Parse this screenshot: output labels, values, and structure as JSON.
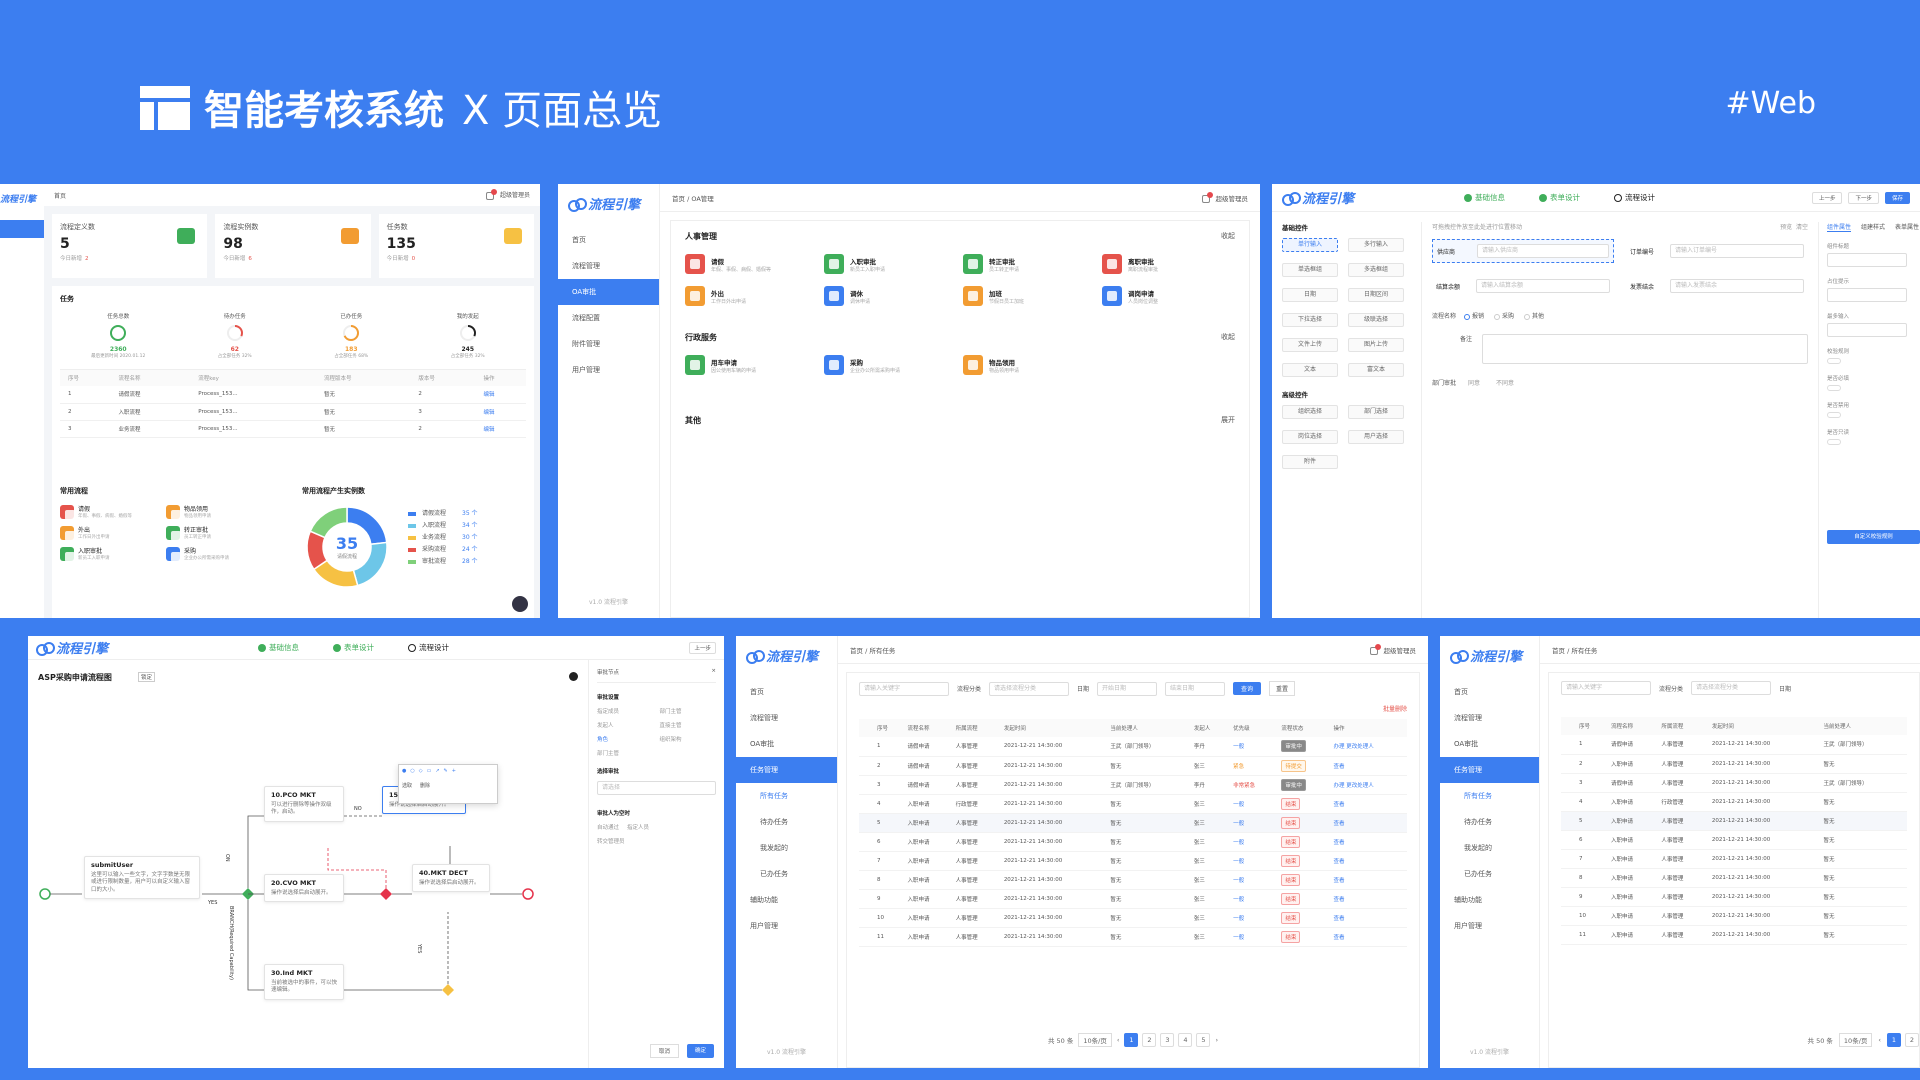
{
  "header": {
    "title": "智能考核系统",
    "subtitle": "X 页面总览",
    "tag": "#Web"
  },
  "brand": "流程引擎",
  "version": "v1.0 流程引擎",
  "dashboard": {
    "crumb": "首页",
    "user": "超级管理员",
    "stats": [
      {
        "label": "流程定义数",
        "value": "5",
        "sub_label": "今日新增",
        "sub_value": "2",
        "color": "#3fae5a"
      },
      {
        "label": "流程实例数",
        "value": "98",
        "sub_label": "今日新增",
        "sub_value": "6",
        "color": "#f29c32"
      },
      {
        "label": "任务数",
        "value": "135",
        "sub_label": "今日新增",
        "sub_value": "0",
        "color": "#f6c143"
      }
    ],
    "task_title": "任务",
    "task_stats": [
      {
        "label": "任务总数",
        "value": "2360",
        "note": "最后更新时间 2020.01.12",
        "progress": 1.0,
        "color": "#3fae5a"
      },
      {
        "label": "待办任务",
        "value": "62",
        "note": "占全部任务 32%",
        "progress": 0.32,
        "color": "#e5534b"
      },
      {
        "label": "已办任务",
        "value": "183",
        "note": "占全部任务 68%",
        "progress": 0.68,
        "color": "#f29c32"
      },
      {
        "label": "我的发起",
        "value": "245",
        "note": "占全部任务 32%",
        "progress": 0.32,
        "color": "#222"
      }
    ],
    "table_headers": [
      "序号",
      "流程名称",
      "流程key",
      "流程版本号",
      "版本号",
      "操作"
    ],
    "table_rows": [
      [
        "1",
        "请假流程",
        "Process_153...",
        "暂无",
        "2",
        "编辑"
      ],
      [
        "2",
        "入职流程",
        "Process_153...",
        "暂无",
        "3",
        "编辑"
      ],
      [
        "3",
        "业务流程",
        "Process_153...",
        "暂无",
        "2",
        "编辑"
      ]
    ],
    "common_title": "常用流程",
    "common": [
      {
        "name": "请假",
        "desc": "年假、事假、病假、婚假等",
        "color": "red"
      },
      {
        "name": "物品领用",
        "desc": "物品领用申请",
        "color": "orange"
      },
      {
        "name": "外出",
        "desc": "工作日外出申请",
        "color": "orange"
      },
      {
        "name": "转正审批",
        "desc": "员工转正申请",
        "color": "green"
      },
      {
        "name": "入职审批",
        "desc": "新员工入职申请",
        "color": "green"
      },
      {
        "name": "采购",
        "desc": "企业办公所需采购申请",
        "color": "blue"
      }
    ],
    "donut_title": "常用流程产生实例数",
    "donut_center": "35",
    "donut_center_label": "请假流程",
    "legend": [
      {
        "name": "请假流程",
        "value": "35 个",
        "color": "#3c7ef0"
      },
      {
        "name": "入职流程",
        "value": "34 个",
        "color": "#6dc6e8"
      },
      {
        "name": "业务流程",
        "value": "30 个",
        "color": "#f6c143"
      },
      {
        "name": "采购流程",
        "value": "24 个",
        "color": "#e5534b"
      },
      {
        "name": "审批流程",
        "value": "28 个",
        "color": "#7fd07a"
      }
    ]
  },
  "oa": {
    "crumb": "首页 / OA管理",
    "user": "超级管理员",
    "menu": [
      {
        "label": "首页",
        "on": false
      },
      {
        "label": "流程管理",
        "on": false
      },
      {
        "label": "OA审批",
        "on": true
      },
      {
        "label": "流程配置",
        "on": false
      },
      {
        "label": "附件管理",
        "on": false
      },
      {
        "label": "用户管理",
        "on": false
      }
    ],
    "section1": "人事管理",
    "section1_items": [
      {
        "name": "请假",
        "desc": "年假、事假、病假、婚假等",
        "color": "red"
      },
      {
        "name": "入职审批",
        "desc": "新员工入职申请",
        "color": "green"
      },
      {
        "name": "转正审批",
        "desc": "员工转正申请",
        "color": "green"
      },
      {
        "name": "离职审批",
        "desc": "离职流程审批",
        "color": "red"
      },
      {
        "name": "外出",
        "desc": "工作日外出申请",
        "color": "orange"
      },
      {
        "name": "调休",
        "desc": "调休申请",
        "color": "blue"
      },
      {
        "name": "加班",
        "desc": "节假日员工加班",
        "color": "orange"
      },
      {
        "name": "调岗申请",
        "desc": "人员岗位调整",
        "color": "blue"
      }
    ],
    "section2": "行政服务",
    "section2_items": [
      {
        "name": "用车申请",
        "desc": "因公使用车辆的申请",
        "color": "green"
      },
      {
        "name": "采购",
        "desc": "企业办公所需采购申请",
        "color": "blue"
      },
      {
        "name": "物品领用",
        "desc": "物品领用申请",
        "color": "orange"
      }
    ],
    "section3": "其他",
    "collapse": "收起",
    "expand": "展开"
  },
  "form": {
    "steps": [
      "基础信息",
      "表单设计",
      "流程设计"
    ],
    "buttons": [
      "上一步",
      "下一步",
      "保存"
    ],
    "basic": "基础控件",
    "controls": [
      "单行输入",
      "多行输入",
      "单选框组",
      "多选框组",
      "日期",
      "日期区间",
      "下拉选择",
      "级联选择",
      "文件上传",
      "图片上传",
      "文本",
      "富文本"
    ],
    "advanced": "高级控件",
    "adv_controls": [
      "组织选择",
      "部门选择",
      "岗位选择",
      "用户选择",
      "附件"
    ],
    "hint": "可拖拽控件放至此处进行位置移动",
    "preview": "预览",
    "clear": "清空",
    "fields": [
      {
        "label": "供应商",
        "ph": "请输入供应商"
      },
      {
        "label": "订单编号",
        "ph": "请输入订单编号"
      },
      {
        "label": "结算余额",
        "ph": "请输入结算余额"
      },
      {
        "label": "发票结余",
        "ph": "请输入发票结余"
      }
    ],
    "radio_label": "流程名称",
    "radios": [
      "报销",
      "采购",
      "其他"
    ],
    "remark": "备注",
    "dept_label": "部门审批",
    "dept_opts": [
      "同意",
      "不同意"
    ],
    "tabs": [
      "组件属性",
      "组建样式",
      "表单属性"
    ],
    "props": [
      "组件标题",
      "占位提示",
      "最多输入",
      "校验规则",
      "是否必填",
      "是否禁用",
      "是否只读"
    ],
    "save_btn": "自定义校验规则"
  },
  "flow": {
    "steps": [
      "基础信息",
      "表单设计",
      "流程设计"
    ],
    "prev": "上一步",
    "title": "ASP采购申请流程图",
    "lock": "锁定",
    "nodes": [
      {
        "name": "submitUser",
        "desc": "这里可以输入一些文字，文字字数是无限或进行限制数量，用户可以自定义输入窗口的大小。"
      },
      {
        "name": "10.PCO MKT",
        "desc": "可以进行删除等操作双级作，启动。"
      },
      {
        "name": "20.CVO MKT",
        "desc": "操作说选择后启动展开。"
      },
      {
        "name": "15.PCO MKT",
        "desc": "操作说选择后启动展开。"
      },
      {
        "name": "40.MKT DECT",
        "desc": "操作说选择后启动展开。"
      },
      {
        "name": "30.Ind MKT",
        "desc": "当前被选中的事件，可以快速编辑。"
      }
    ],
    "labels": [
      "YES",
      "NO",
      "ON",
      "YES",
      "BRANCH(Required Capability)"
    ],
    "popup": [
      "选取",
      "删除"
    ],
    "panel_title": "审批节点",
    "panel_sections": [
      "审批设置",
      "选择审批",
      "审批人为空时"
    ],
    "panel_opts": [
      "指定成员",
      "部门主管",
      "发起人",
      "直接主管",
      "角色",
      "组织架构",
      "部门主管",
      "请选择",
      "自动通过",
      "指定人员",
      "转交管理员"
    ],
    "cancel": "取消",
    "ok": "确定"
  },
  "list": {
    "crumb": "首页 / 所有任务",
    "user": "超级管理员",
    "menu": [
      {
        "label": "首页",
        "on": false,
        "sub": false
      },
      {
        "label": "流程管理",
        "on": false,
        "sub": false
      },
      {
        "label": "OA审批",
        "on": false,
        "sub": false
      },
      {
        "label": "任务管理",
        "on": true,
        "sub": false
      },
      {
        "label": "所有任务",
        "on": false,
        "sub": true,
        "active": true
      },
      {
        "label": "待办任务",
        "on": false,
        "sub": true
      },
      {
        "label": "我发起的",
        "on": false,
        "sub": true
      },
      {
        "label": "已办任务",
        "on": false,
        "sub": true
      },
      {
        "label": "辅助功能",
        "on": false,
        "sub": false
      },
      {
        "label": "用户管理",
        "on": false,
        "sub": false
      }
    ],
    "search_ph": "请输入关键字",
    "cat_label": "流程分类",
    "cat_ph": "请选择流程分类",
    "date_label": "日期",
    "date_ph": [
      "开始日期",
      "结束日期"
    ],
    "query": "查询",
    "reset": "重置",
    "batch_del": "批量删除",
    "headers": [
      "序号",
      "流程名称",
      "所属流程",
      "发起时间",
      "当前处理人",
      "发起人",
      "优先级",
      "流程状态",
      "操作"
    ],
    "rows": [
      [
        "1",
        "请假申请",
        "人事管理",
        "2021-12-21 14:30:00",
        "王武（部门领导）",
        "李丹",
        "一般",
        "审批中",
        "办理  更改处理人"
      ],
      [
        "2",
        "请假申请",
        "人事管理",
        "2021-12-21 14:30:00",
        "暂无",
        "张三",
        "紧急",
        "待提交",
        "查看"
      ],
      [
        "3",
        "请假申请",
        "人事管理",
        "2021-12-21 14:30:00",
        "王武（部门领导）",
        "李丹",
        "非常紧急",
        "审批中",
        "办理  更改处理人"
      ],
      [
        "4",
        "入职申请",
        "行政管理",
        "2021-12-21 14:30:00",
        "暂无",
        "张三",
        "一般",
        "结束",
        "查看"
      ],
      [
        "5",
        "入职申请",
        "人事管理",
        "2021-12-21 14:30:00",
        "暂无",
        "张三",
        "一般",
        "结束",
        "查看"
      ],
      [
        "6",
        "入职申请",
        "人事管理",
        "2021-12-21 14:30:00",
        "暂无",
        "张三",
        "一般",
        "结束",
        "查看"
      ],
      [
        "7",
        "入职申请",
        "人事管理",
        "2021-12-21 14:30:00",
        "暂无",
        "张三",
        "一般",
        "结束",
        "查看"
      ],
      [
        "8",
        "入职申请",
        "人事管理",
        "2021-12-21 14:30:00",
        "暂无",
        "张三",
        "一般",
        "结束",
        "查看"
      ],
      [
        "9",
        "入职申请",
        "人事管理",
        "2021-12-21 14:30:00",
        "暂无",
        "张三",
        "一般",
        "结束",
        "查看"
      ],
      [
        "10",
        "入职申请",
        "人事管理",
        "2021-12-21 14:30:00",
        "暂无",
        "张三",
        "一般",
        "结束",
        "查看"
      ],
      [
        "11",
        "入职申请",
        "人事管理",
        "2021-12-21 14:30:00",
        "暂无",
        "张三",
        "一般",
        "结束",
        "查看"
      ]
    ],
    "total": "共 50 条",
    "per_page": "10条/页",
    "pages": [
      "1",
      "2",
      "3",
      "4",
      "5"
    ]
  },
  "list2": {
    "crumb": "首页 / 所有任务",
    "headers": [
      "序号",
      "流程名称",
      "所属流程",
      "发起时间",
      "当前处理人"
    ],
    "rows": [
      [
        "1",
        "请假申请",
        "人事管理",
        "2021-12-21 14:30:00",
        "王武（部门领导）"
      ],
      [
        "2",
        "入职申请",
        "人事管理",
        "2021-12-21 14:30:00",
        "暂无"
      ],
      [
        "3",
        "请假申请",
        "人事管理",
        "2021-12-21 14:30:00",
        "王武（部门领导）"
      ],
      [
        "4",
        "入职申请",
        "行政管理",
        "2021-12-21 14:30:00",
        "暂无"
      ],
      [
        "5",
        "入职申请",
        "人事管理",
        "2021-12-21 14:30:00",
        "暂无"
      ],
      [
        "6",
        "入职申请",
        "人事管理",
        "2021-12-21 14:30:00",
        "暂无"
      ],
      [
        "7",
        "入职申请",
        "人事管理",
        "2021-12-21 14:30:00",
        "暂无"
      ],
      [
        "8",
        "入职申请",
        "人事管理",
        "2021-12-21 14:30:00",
        "暂无"
      ],
      [
        "9",
        "入职申请",
        "人事管理",
        "2021-12-21 14:30:00",
        "暂无"
      ],
      [
        "10",
        "入职申请",
        "人事管理",
        "2021-12-21 14:30:00",
        "暂无"
      ],
      [
        "11",
        "入职申请",
        "人事管理",
        "2021-12-21 14:30:00",
        "暂无"
      ]
    ],
    "total": "共 50 条",
    "per_page": "10条/页",
    "pages": [
      "1",
      "2"
    ]
  }
}
